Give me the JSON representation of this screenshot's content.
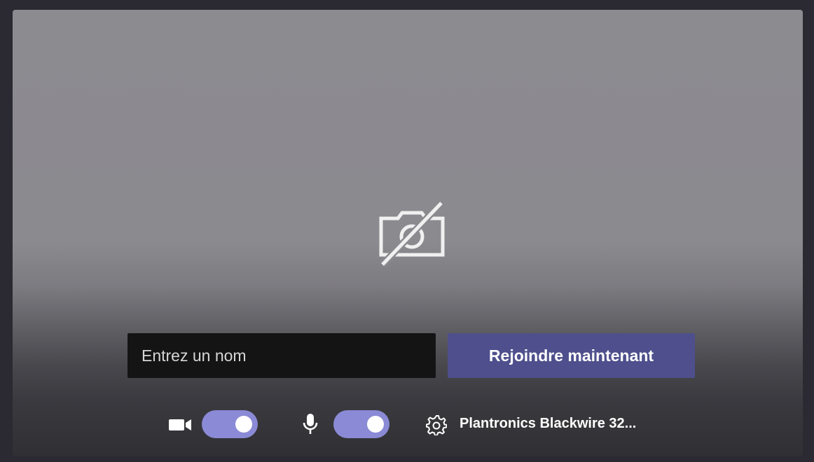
{
  "preview": {
    "camera_off_icon": "camera-off-icon"
  },
  "join": {
    "name_placeholder": "Entrez un nom",
    "name_value": "",
    "join_button_label": "Rejoindre maintenant"
  },
  "controls": {
    "camera": {
      "icon": "video-camera-icon",
      "enabled": true
    },
    "microphone": {
      "icon": "microphone-icon",
      "enabled": true
    },
    "settings_icon": "gear-icon",
    "device_label": "Plantronics Blackwire 32..."
  },
  "colors": {
    "accent": "#4e4f8c",
    "toggle_on": "#8a8ad6",
    "input_bg": "#141414",
    "window_bg": "#2b2a33"
  }
}
